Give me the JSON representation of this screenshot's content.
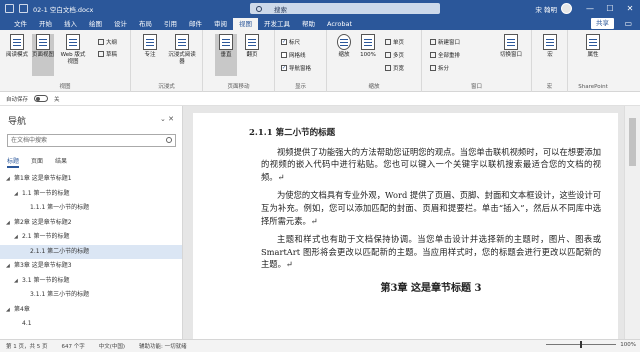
{
  "window": {
    "title": "02-1 空白文档.docx",
    "search_placeholder": "搜索",
    "user": "宋 翰明",
    "minimize": "—",
    "maximize": "☐",
    "close": "✕"
  },
  "tabs": [
    "文件",
    "开始",
    "插入",
    "绘图",
    "设计",
    "布局",
    "引用",
    "邮件",
    "审阅",
    "视图",
    "开发工具",
    "帮助",
    "Acrobat"
  ],
  "active_tab": "视图",
  "share_label": "共享",
  "ribbon": {
    "groups": {
      "views": {
        "label": "视图",
        "read_mode": "阅读模式",
        "print_layout": "页面视图",
        "web_layout": "Web 版式视图",
        "outline": "大纲",
        "draft": "草稿"
      },
      "immersive": {
        "label": "沉浸式",
        "focus": "专注",
        "immersive_reader": "沉浸式阅读器"
      },
      "page_movement": {
        "label": "页面移动",
        "vertical": "垂直",
        "side_to_side": "翻页"
      },
      "show": {
        "label": "显示",
        "ruler": "标尺",
        "gridlines": "网格线",
        "nav_pane": "导航窗格"
      },
      "zoom": {
        "label": "缩放",
        "zoom": "缩放",
        "hundred": "100%",
        "one_page": "单页",
        "multiple_pages": "多页",
        "page_width": "页宽"
      },
      "window": {
        "label": "窗口",
        "new_window": "新建窗口",
        "arrange_all": "全部重排",
        "split": "拆分",
        "switch_windows": "切换窗口"
      },
      "macros": {
        "label": "宏",
        "macros": "宏"
      },
      "sharepoint": {
        "label": "SharePoint",
        "properties": "属性"
      }
    }
  },
  "qat": {
    "autosave": "自动保存",
    "autosave_state": "关"
  },
  "navigation": {
    "title": "导航",
    "search_placeholder": "在文档中搜索",
    "tabs": [
      "标题",
      "页面",
      "结果"
    ],
    "tree": [
      {
        "level": 0,
        "label": "第1章 这是章节标题1",
        "expanded": true
      },
      {
        "level": 1,
        "label": "1.1 第一节的标题",
        "expanded": true
      },
      {
        "level": 2,
        "label": "1.1.1 第一小节的标题"
      },
      {
        "level": 0,
        "label": "第2章 这是章节标题2",
        "expanded": true
      },
      {
        "level": 1,
        "label": "2.1 第一节的标题",
        "expanded": true
      },
      {
        "level": 2,
        "label": "2.1.1 第二小节的标题",
        "selected": true
      },
      {
        "level": 0,
        "label": "第3章 这是章节标题3",
        "expanded": true
      },
      {
        "level": 1,
        "label": "3.1 第一节的标题",
        "expanded": true
      },
      {
        "level": 2,
        "label": "3.1.1 第三小节的标题"
      },
      {
        "level": 0,
        "label": "第4章",
        "expanded": true
      },
      {
        "level": 1,
        "label": "4.1"
      }
    ]
  },
  "document": {
    "heading2": "2.1.1  第二小节的标题",
    "paragraphs": [
      "视频提供了功能强大的方法帮助您证明您的观点。当您单击联机视频时，可以在想要添加的视频的嵌入代码中进行粘贴。您也可以键入一个关键字以联机搜索最适合您的文档的视频。↵",
      "为使您的文档具有专业外观，Word 提供了页眉、页脚、封面和文本框设计，这些设计可互为补充。例如，您可以添加匹配的封面、页眉和提要栏。单击“插入”，然后从不同库中选择所需元素。↵",
      "主题和样式也有助于文档保持协调。当您单击设计并选择新的主题时，图片、图表或 SmartArt 图形将会更改以匹配新的主题。当应用样式时，您的标题会进行更改以匹配新的主题。↵"
    ],
    "heading1": "第3章  这是章节标题 3"
  },
  "status": {
    "page": "第 1 页，共 5 页",
    "words": "647 个字",
    "language": "中文(中国)",
    "accessibility": "辅助功能: 一切就绪",
    "zoom": "100%"
  },
  "colors": {
    "brand": "#2b579a",
    "selection": "#dbe6f4"
  }
}
